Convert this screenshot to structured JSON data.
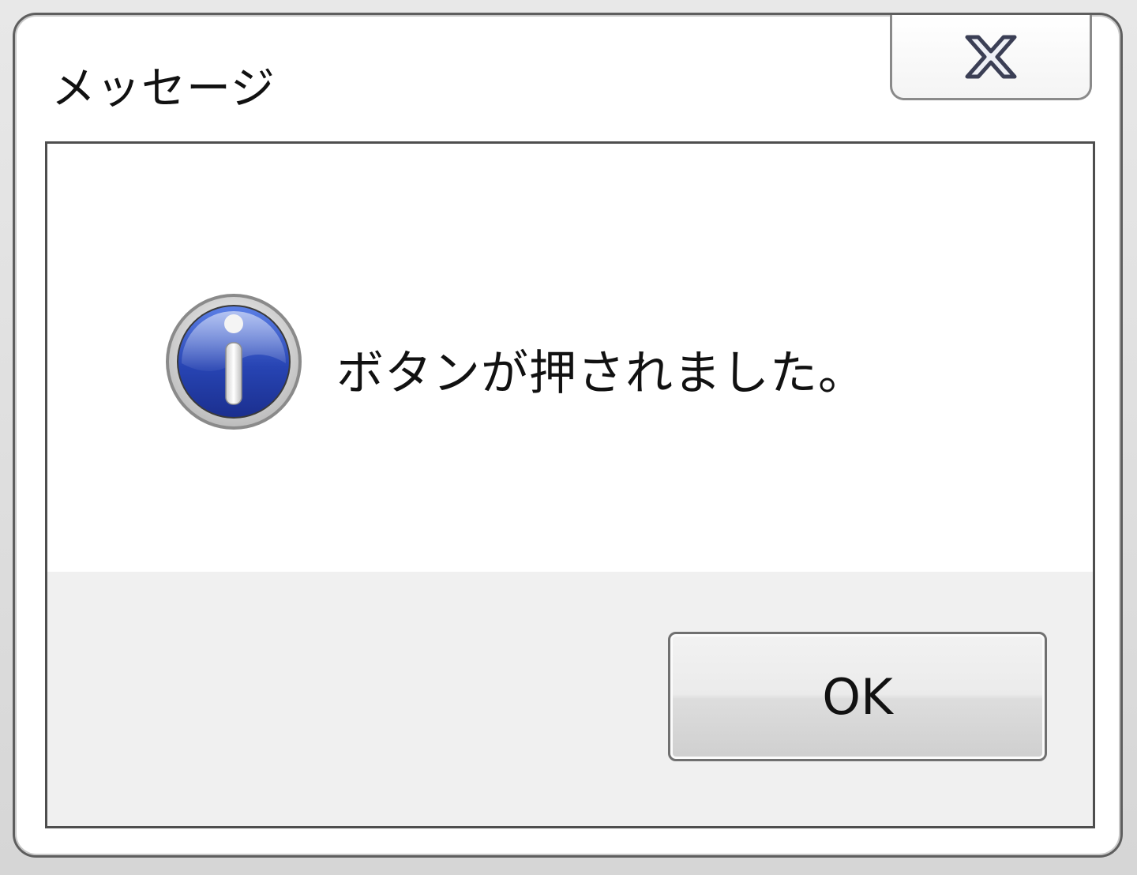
{
  "window": {
    "title": "メッセージ",
    "close_icon": "close-icon"
  },
  "message": {
    "icon": "info-icon",
    "text": "ボタンが押されました。"
  },
  "buttons": {
    "ok_label": "OK"
  },
  "colors": {
    "icon_blue": "#2748b8",
    "button_strip": "#f0f0f0",
    "window_border": "#5e5e5e"
  }
}
